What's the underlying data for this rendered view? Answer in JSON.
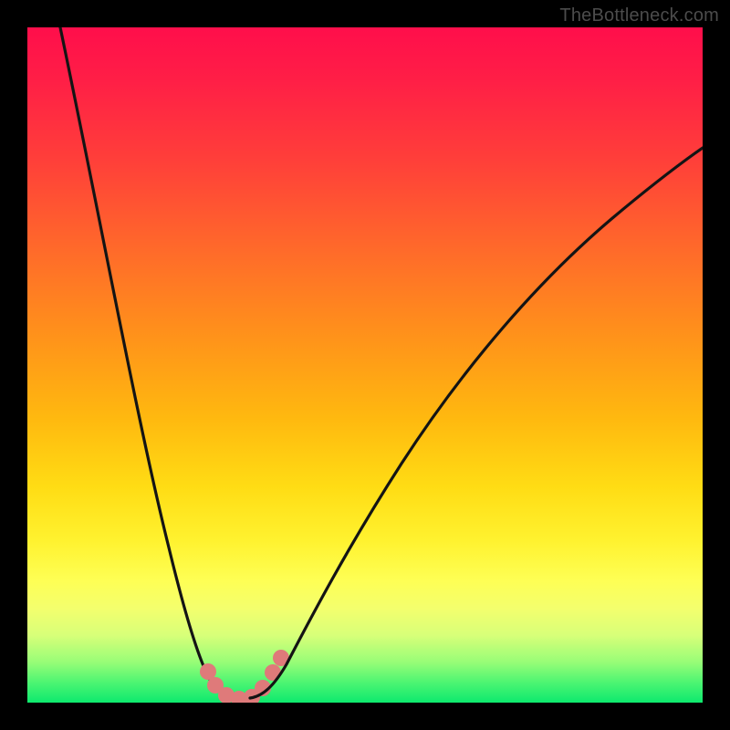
{
  "watermark": "TheBottleneck.com",
  "colors": {
    "frame": "#000000",
    "watermark": "#4c4c4c",
    "curve": "#141414",
    "marker": "#df7a7a",
    "gradient_stops": [
      "#ff0e4b",
      "#ff4039",
      "#ff931a",
      "#ffdc14",
      "#feff55",
      "#d8ff79",
      "#4df572",
      "#0de96e"
    ]
  },
  "chart_data": {
    "type": "line",
    "title": "",
    "xlabel": "",
    "ylabel": "",
    "xlim": [
      0,
      100
    ],
    "ylim": [
      0,
      100
    ],
    "series": [
      {
        "name": "bottleneck-curve",
        "x": [
          5,
          10,
          15,
          20,
          24,
          27,
          29,
          30,
          31,
          33,
          36,
          40,
          50,
          60,
          75,
          90,
          100
        ],
        "y": [
          100,
          72,
          48,
          27,
          12,
          4,
          1,
          0,
          0.5,
          2,
          6,
          16,
          38,
          55,
          72,
          82,
          86
        ]
      }
    ],
    "markers": {
      "name": "trough-points",
      "x": [
        27,
        28,
        29.5,
        31,
        33,
        35,
        36.5,
        37.5
      ],
      "y": [
        4.5,
        2.5,
        1,
        0.5,
        0.8,
        2,
        4,
        6.5
      ]
    },
    "background": {
      "style": "vertical-gradient",
      "meaning": "red (top) = high bottleneck, green (bottom) = low bottleneck"
    }
  }
}
